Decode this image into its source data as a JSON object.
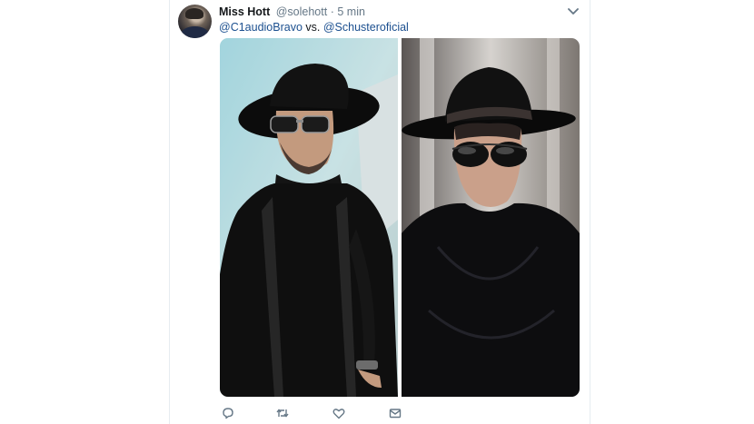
{
  "tweet": {
    "author_name": "Miss Hott",
    "author_handle": "@solehott",
    "separator": "·",
    "time": "5 min",
    "mention_1": "@C1audioBravo",
    "connector": " vs. ",
    "mention_2": "@Schusteroficial"
  },
  "actions": [
    "reply-icon",
    "retweet-icon",
    "like-icon",
    "message-icon"
  ],
  "colors": {
    "name": "#14171a",
    "secondary": "#657786",
    "mention": "#1b4f8f",
    "icon": "#657786"
  }
}
